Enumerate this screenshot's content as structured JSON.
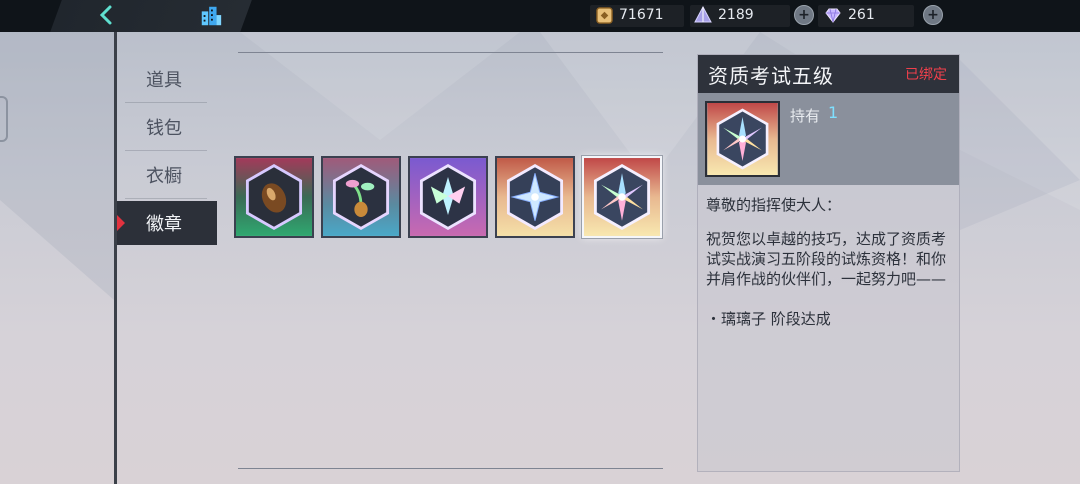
{
  "topbar": {
    "back_icon": "chevron-left-icon",
    "home_icon": "building-icon",
    "currencies": [
      {
        "icon": "coin-icon",
        "value": "71671"
      },
      {
        "icon": "crystal-pyramid-icon",
        "value": "2189"
      },
      {
        "icon": "diamond-icon",
        "value": "261"
      }
    ]
  },
  "nav": {
    "items": [
      {
        "label": "道具"
      },
      {
        "label": "钱包"
      },
      {
        "label": "衣橱"
      },
      {
        "label": "徽章"
      }
    ],
    "active_index": 3
  },
  "inventory": {
    "slots": [
      {
        "icon": "seed-badge-icon"
      },
      {
        "icon": "sprout-badge-icon"
      },
      {
        "icon": "crystal-leaf-badge-icon"
      },
      {
        "icon": "crystal-star-badge-icon"
      },
      {
        "icon": "crystal-flower-badge-icon",
        "selected": true
      }
    ]
  },
  "detail": {
    "title": "资质考试五级",
    "bound": "已绑定",
    "own_label": "持有",
    "own_count": "1",
    "greeting": "尊敬的指挥使大人：",
    "body": "祝贺您以卓越的技巧，达成了资质考试实战演习五阶段的试炼资格！和你并肩作战的伙伴们，一起努力吧——",
    "bullet": "・璃璃子 阶段达成"
  },
  "colors": {
    "topbar": "#0f1419",
    "active_nav": "#2c3039",
    "accent_red": "#e2323f",
    "bound_red": "#f0404c",
    "count_cyan": "#7fe0ff",
    "back_teal": "#5fe0d0"
  }
}
